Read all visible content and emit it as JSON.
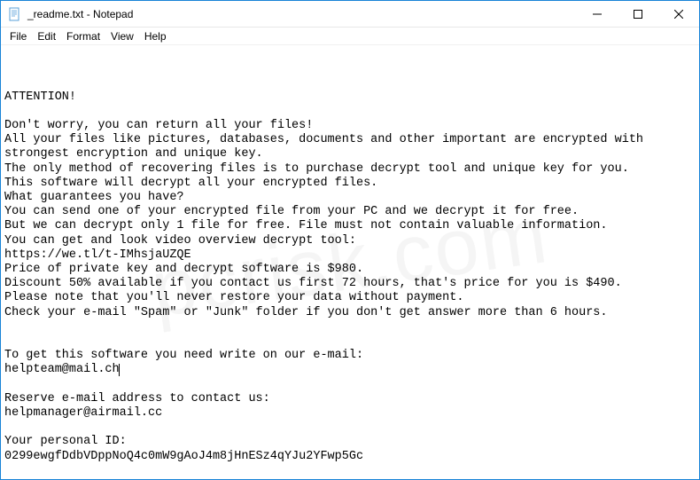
{
  "titlebar": {
    "title": "_readme.txt - Notepad"
  },
  "menubar": {
    "items": [
      "File",
      "Edit",
      "Format",
      "View",
      "Help"
    ]
  },
  "content": {
    "lines": [
      "ATTENTION!",
      "",
      "Don't worry, you can return all your files!",
      "All your files like pictures, databases, documents and other important are encrypted with strongest encryption and unique key.",
      "The only method of recovering files is to purchase decrypt tool and unique key for you.",
      "This software will decrypt all your encrypted files.",
      "What guarantees you have?",
      "You can send one of your encrypted file from your PC and we decrypt it for free.",
      "But we can decrypt only 1 file for free. File must not contain valuable information.",
      "You can get and look video overview decrypt tool:",
      "https://we.tl/t-IMhsjaUZQE",
      "Price of private key and decrypt software is $980.",
      "Discount 50% available if you contact us first 72 hours, that's price for you is $490.",
      "Please note that you'll never restore your data without payment.",
      "Check your e-mail \"Spam\" or \"Junk\" folder if you don't get answer more than 6 hours.",
      "",
      "",
      "To get this software you need write on our e-mail:",
      "helpteam@mail.ch",
      "",
      "Reserve e-mail address to contact us:",
      "helpmanager@airmail.cc",
      "",
      "Your personal ID:",
      "0299ewgfDdbVDppNoQ4c0mW9gAoJ4m8jHnESz4qYJu2YFwp5Gc"
    ],
    "caret_line": 18
  }
}
